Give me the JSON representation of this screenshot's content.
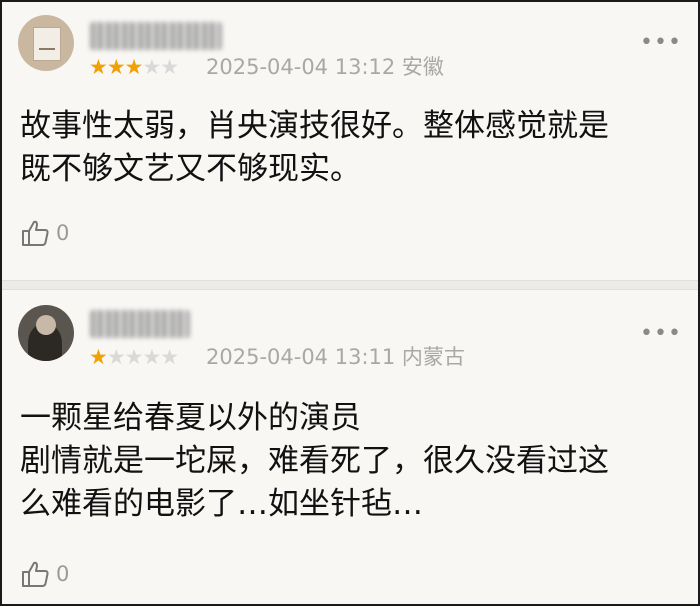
{
  "comments": [
    {
      "stars_filled": 3,
      "stars_total": 5,
      "stars_on": "★★★",
      "stars_off": "★★",
      "meta": "2025-04-04 13:12 安徽",
      "more_icon": "more-dots-icon",
      "text": "故事性太弱，肖央演技很好。整体感觉就是\n既不够文艺又不够现实。",
      "like_icon": "thumbs-up-icon",
      "likes": "0"
    },
    {
      "stars_filled": 1,
      "stars_total": 5,
      "stars_on": "★",
      "stars_off": "★★★★",
      "meta": "2025-04-04 13:11 内蒙古",
      "more_icon": "more-dots-icon",
      "text": "一颗星给春夏以外的演员\n剧情就是一坨屎，难看死了，很久没看过这\n么难看的电影了…如坐针毡…",
      "like_icon": "thumbs-up-icon",
      "likes": "0"
    }
  ],
  "colors": {
    "star_active": "#f2a104",
    "star_inactive": "#d9d9d9",
    "meta_text": "#a8a8a8",
    "body_text": "#111111"
  }
}
